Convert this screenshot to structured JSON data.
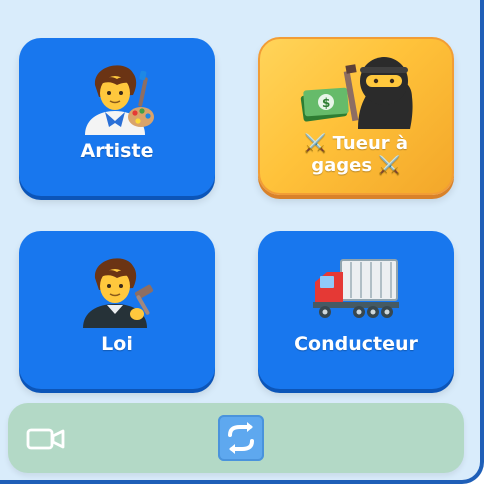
{
  "cards": [
    {
      "label": "Artiste",
      "icon": "artist-icon"
    },
    {
      "label_line1": "⚔️ Tueur à",
      "label_line2": "gages ⚔️",
      "icon": "ninja-icon",
      "secondary_icon": "money-icon"
    },
    {
      "label": "Loi",
      "icon": "judge-icon"
    },
    {
      "label": "Conducteur",
      "icon": "truck-icon"
    }
  ],
  "bottom_bar": {
    "left_icon": "video-camera-icon",
    "center_icon": "repeat-arrows-icon"
  },
  "colors": {
    "background": "#d9ecfb",
    "card_blue": "#1877ee",
    "card_gold": "#ffc23a",
    "bottom_bar": "#b3d9c6"
  }
}
